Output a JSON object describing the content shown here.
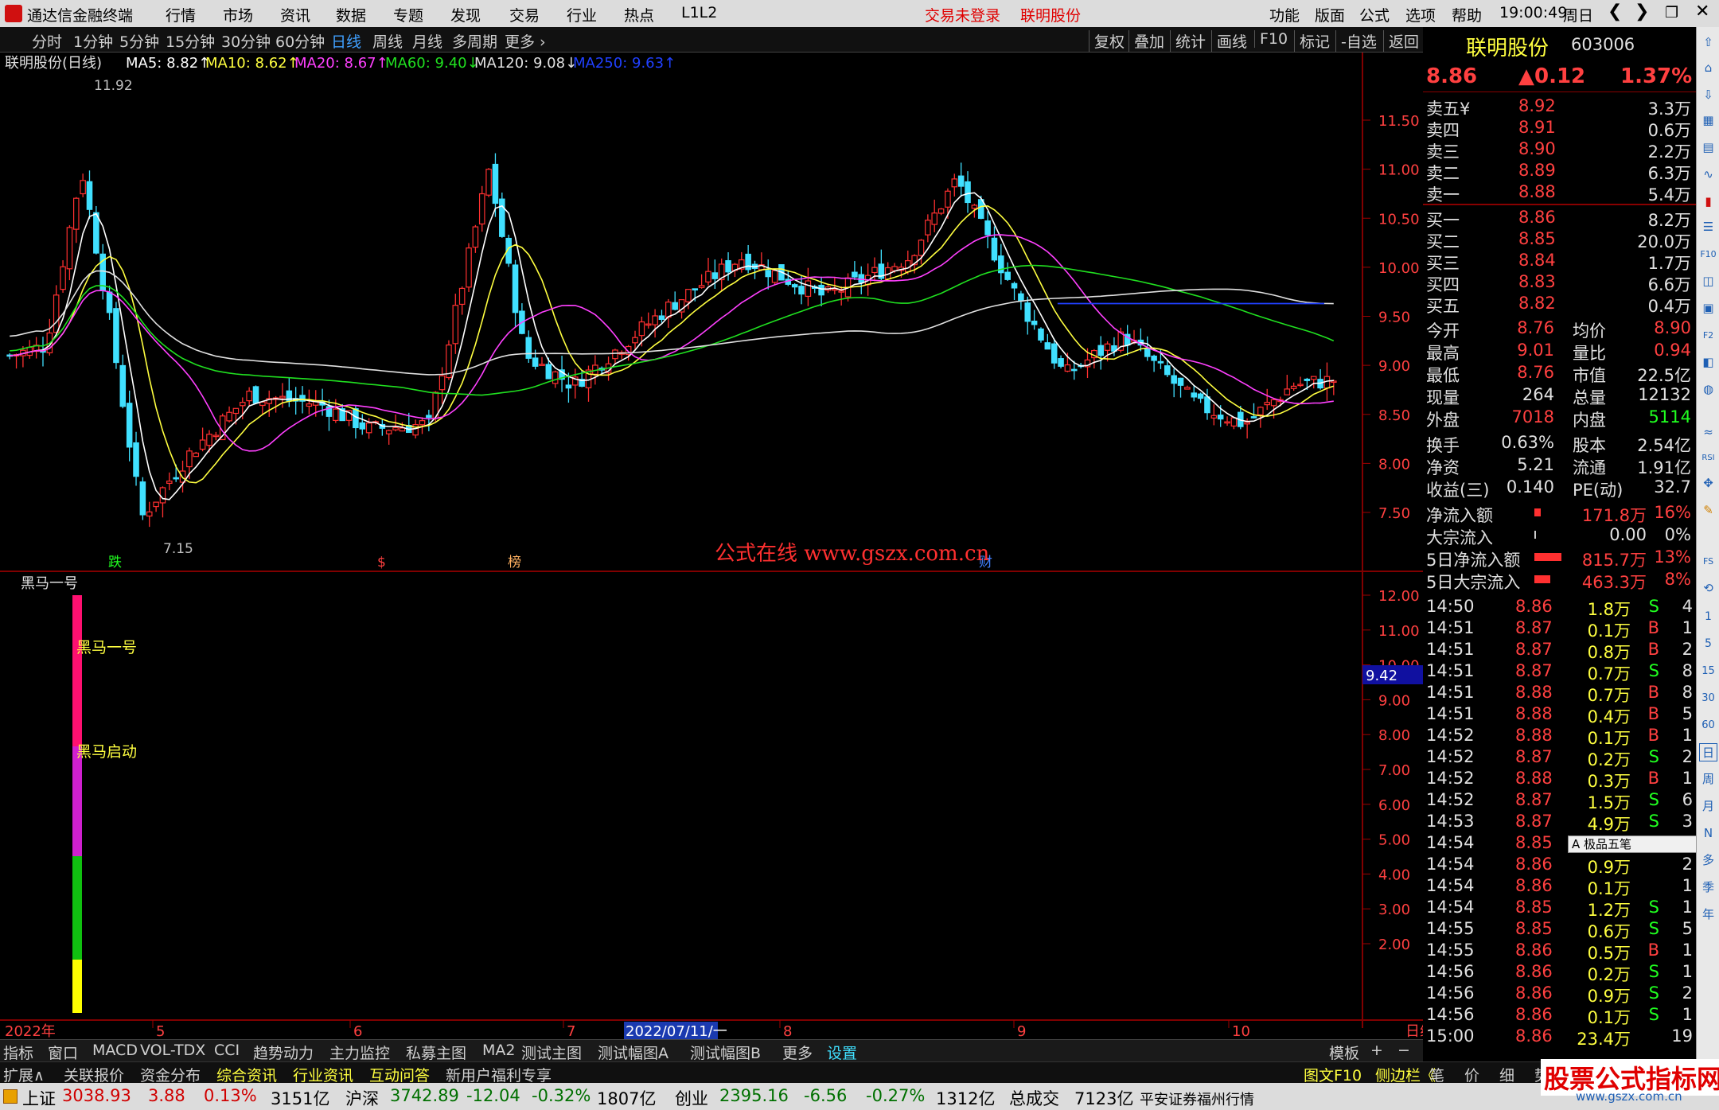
{
  "app": {
    "title": "通达信金融终端",
    "menu": [
      "行情",
      "市场",
      "资讯",
      "数据",
      "专题",
      "发现",
      "交易",
      "行业",
      "热点",
      "L1L2"
    ],
    "trade_status": "交易未登录",
    "stock_link": "联明股份",
    "right_menu": [
      "功能",
      "版面",
      "公式",
      "选项",
      "帮助"
    ],
    "time": "19:00:49",
    "weekday": "周日"
  },
  "timeframes": [
    "分时",
    "1分钟",
    "5分钟",
    "15分钟",
    "30分钟",
    "60分钟",
    "日线",
    "周线",
    "月线",
    "多周期",
    "更多 ›"
  ],
  "active_timeframe": "日线",
  "chart_tools": [
    "复权",
    "叠加",
    "统计",
    "画线",
    "F10",
    "标记",
    "-自选",
    "返回"
  ],
  "ma_header": {
    "name": "联明股份(日线)",
    "ma5": "MA5: 8.82↑",
    "ma10": "MA10: 8.62↑",
    "ma20": "MA20: 8.67↑",
    "ma60": "MA60: 9.40↓",
    "ma120": "MA120: 9.08↓",
    "ma250": "MA250: 9.63↑"
  },
  "price_axis": [
    "11.50",
    "11.00",
    "10.50",
    "10.00",
    "9.50",
    "9.00",
    "8.50",
    "8.00",
    "7.50"
  ],
  "indicator_axis": [
    "12.00",
    "11.00",
    "10.00",
    "9.00",
    "8.00",
    "7.00",
    "6.00",
    "5.00",
    "4.00",
    "3.00",
    "2.00"
  ],
  "indicator_marker": "9.42",
  "high_label": "11.92",
  "low_label": "7.15",
  "event_markers": [
    "跌",
    "$",
    "榜",
    "财"
  ],
  "watermark": "公式在线  www.gszx.com.cn",
  "indicator": {
    "name": "黑马一号",
    "label1": "黑马一号",
    "label2": "黑马启动"
  },
  "date_axis": [
    "2022年",
    "5",
    "6",
    "7",
    "2022/07/11/一",
    "8",
    "9",
    "10",
    "日线"
  ],
  "chart_data": {
    "type": "candlestick",
    "title": "联明股份(日线)",
    "ylim": [
      7.15,
      11.92
    ],
    "high": 11.92,
    "low": 7.15
  },
  "quote": {
    "name": "联明股份",
    "code": "603006",
    "price": "8.86",
    "change": "▲0.12",
    "pct": "1.37%",
    "asks": [
      [
        "卖五¥",
        "8.92",
        "3.3万"
      ],
      [
        "卖四",
        "8.91",
        "0.6万"
      ],
      [
        "卖三",
        "8.90",
        "2.2万"
      ],
      [
        "卖二",
        "8.89",
        "6.3万"
      ],
      [
        "卖一",
        "8.88",
        "5.4万"
      ]
    ],
    "bids": [
      [
        "买一",
        "8.86",
        "8.2万"
      ],
      [
        "买二",
        "8.85",
        "20.0万"
      ],
      [
        "买三",
        "8.84",
        "1.7万"
      ],
      [
        "买四",
        "8.83",
        "6.6万"
      ],
      [
        "买五",
        "8.82",
        "0.4万"
      ]
    ],
    "stats": [
      [
        "今开",
        "8.76",
        "均价",
        "8.90"
      ],
      [
        "最高",
        "9.01",
        "量比",
        "0.94"
      ],
      [
        "最低",
        "8.76",
        "市值",
        "22.5亿"
      ],
      [
        "现量",
        "264",
        "总量",
        "12132"
      ],
      [
        "外盘",
        "7018",
        "内盘",
        "5114"
      ]
    ],
    "stats2": [
      [
        "换手",
        "0.63%",
        "股本",
        "2.54亿"
      ],
      [
        "净资",
        "5.21",
        "流通",
        "1.91亿"
      ],
      [
        "收益(三)",
        "0.140",
        "PE(动)",
        "32.7"
      ]
    ],
    "flows": [
      [
        "净流入额",
        "171.8万",
        "16%"
      ],
      [
        "大宗流入",
        "0.00",
        "0%"
      ],
      [
        "5日净流入额",
        "815.7万",
        "13%"
      ],
      [
        "5日大宗流入",
        "463.3万",
        "8%"
      ]
    ],
    "ticks": [
      [
        "14:50",
        "8.86",
        "1.8万",
        "S",
        "4"
      ],
      [
        "14:51",
        "8.87",
        "0.1万",
        "B",
        "1"
      ],
      [
        "14:51",
        "8.87",
        "0.8万",
        "B",
        "2"
      ],
      [
        "14:51",
        "8.87",
        "0.7万",
        "S",
        "8"
      ],
      [
        "14:51",
        "8.88",
        "0.7万",
        "B",
        "8"
      ],
      [
        "14:51",
        "8.88",
        "0.4万",
        "B",
        "5"
      ],
      [
        "14:52",
        "8.88",
        "0.1万",
        "B",
        "1"
      ],
      [
        "14:52",
        "8.87",
        "0.2万",
        "S",
        "2"
      ],
      [
        "14:52",
        "8.88",
        "0.3万",
        "B",
        "1"
      ],
      [
        "14:52",
        "8.87",
        "1.5万",
        "S",
        "6"
      ],
      [
        "14:53",
        "8.87",
        "4.9万",
        "S",
        "3"
      ],
      [
        "14:54",
        "8.85",
        "",
        "",
        ""
      ],
      [
        "14:54",
        "8.86",
        "0.9万",
        "",
        "2"
      ],
      [
        "14:54",
        "8.86",
        "0.1万",
        "",
        "1"
      ],
      [
        "14:54",
        "8.85",
        "1.2万",
        "S",
        "1"
      ],
      [
        "14:55",
        "8.85",
        "0.6万",
        "S",
        "5"
      ],
      [
        "14:55",
        "8.86",
        "0.5万",
        "B",
        "1"
      ],
      [
        "14:56",
        "8.86",
        "0.2万",
        "S",
        "1"
      ],
      [
        "14:56",
        "8.86",
        "0.9万",
        "S",
        "2"
      ],
      [
        "14:56",
        "8.86",
        "0.1万",
        "S",
        "1"
      ],
      [
        "15:00",
        "8.86",
        "23.4万",
        "",
        "19"
      ]
    ],
    "ime": "A 极品五笔"
  },
  "side_tools": [
    "日",
    "周",
    "月",
    "N",
    "多",
    "季",
    "年"
  ],
  "tabs1": [
    "指标",
    "窗口",
    "MACD",
    "VOL-TDX",
    "CCI",
    "趋势动力",
    "主力监控",
    "私募主图",
    "MA2",
    "测试主图",
    "测试幅图A",
    "测试幅图B",
    "更多",
    "设置"
  ],
  "tabs1_right": [
    "模板",
    "+",
    "−"
  ],
  "tabs2": [
    "扩展∧",
    "关联报价",
    "资金分布",
    "综合资讯",
    "行业资讯",
    "互动问答",
    "新用户福利专享"
  ],
  "tabs2_right": [
    "图文F10",
    "侧边栏《",
    "笔",
    "价",
    "细",
    "势"
  ],
  "status": {
    "sh_name": "上证",
    "sh_val": "3038.93",
    "sh_chg": "3.88",
    "sh_pct": "0.13%",
    "sh_amt": "3151亿",
    "hs_name": "沪深",
    "hs_val": "3742.89",
    "hs_chg": "-12.04",
    "hs_pct": "-0.32%",
    "hs_amt": "1807亿",
    "cy_name": "创业",
    "cy_val": "2395.16",
    "cy_chg": "-6.56",
    "cy_pct": "-0.27%",
    "cy_amt": "1312亿",
    "total_label": "总成交",
    "total_amt": "7123亿",
    "broker": "平安证券福州行情",
    "logo": "股票公式指标网",
    "logo_url": "www.gszx.com.cn"
  }
}
